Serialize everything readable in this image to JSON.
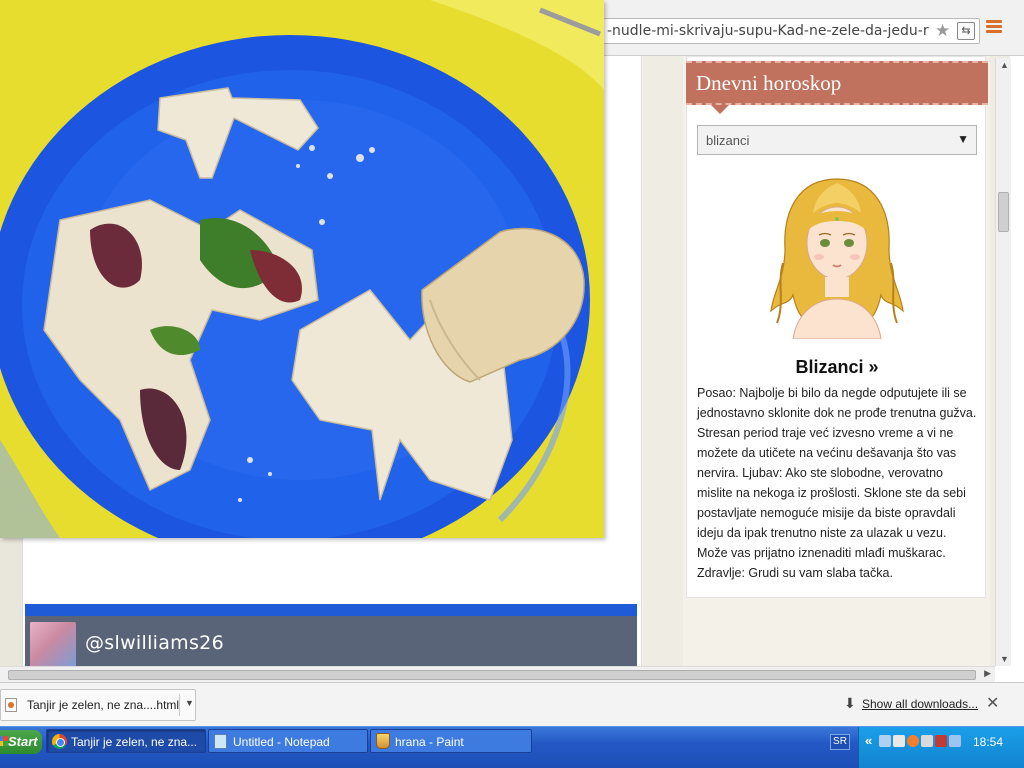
{
  "browser": {
    "url": "-nudle-mi-skrivaju-supu-Kad-ne-zele-da-jedu-r",
    "star_glyph": "★",
    "translate_glyph": "⇆"
  },
  "instagram": {
    "username": "@slwilliams26"
  },
  "horoscope": {
    "title": "Dnevni horoskop",
    "selected_sign": "blizanci",
    "sign_heading": "Blizanci »",
    "text": "Posao: Najbolje bi bilo da negde odputujete ili se jednostavno sklonite dok ne prođe trenutna gužva. Stresan period traje već izvesno vreme a vi ne možete da utičete na većinu dešavanja što vas nervira. Ljubav: Ako ste slobodne, verovatno mislite na nekoga iz prošlosti. Sklone ste da sebi postavljate nemoguće misije da biste opravdali ideju da ipak trenutno niste za ulazak u vezu. Može vas prijatno iznenaditi mlađi muškarac. Zdravlje: Grudi su vam slaba tačka."
  },
  "downloads": {
    "file_name": "Tanjir je zelen, ne zna....html",
    "show_all": "Show all downloads..."
  },
  "taskbar": {
    "start": "Start",
    "tasks": [
      {
        "label": "Tanjir je zelen, ne zna...",
        "icon": "chrome-icon",
        "active": true
      },
      {
        "label": "Untitled - Notepad",
        "icon": "notepad-icon",
        "active": false
      },
      {
        "label": "hrana - Paint",
        "icon": "paint-icon",
        "active": false
      }
    ],
    "language": "SR",
    "clock": "18:54"
  },
  "colors": {
    "plate_blue": "#1c55e0",
    "table_yellow": "#e8e02a",
    "widget_header": "#c0725f",
    "taskbar_blue": "#2458c4"
  }
}
